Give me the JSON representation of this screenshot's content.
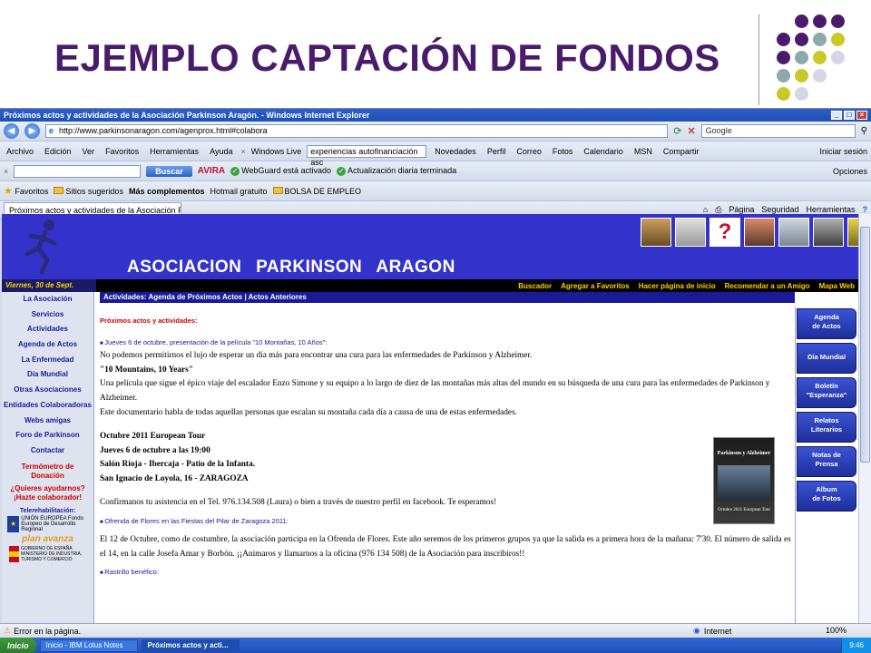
{
  "slide": {
    "title": "EJEMPLO CAPTACIÓN DE FONDOS",
    "dot_colors": [
      "#4b1b6b",
      "#8fa8aa",
      "#c9c92a",
      "#d6d6e6"
    ]
  },
  "browser": {
    "window_title": "Próximos actos y actividades de la Asociación Parkinson Aragón. - Windows Internet Explorer",
    "url": "http://www.parkinsonaragon.com/agenprox.html#colabora",
    "search_placeholder": "Google",
    "menu": [
      "Archivo",
      "Edición",
      "Ver",
      "Favoritos",
      "Herramientas",
      "Ayuda"
    ],
    "live_toolbar": {
      "brand": "Windows Live",
      "search_value": "experiencias autofinanciación asc",
      "links": [
        "Novedades",
        "Perfil",
        "Correo",
        "Fotos",
        "Calendario",
        "MSN",
        "Compartir"
      ],
      "signin": "Iniciar sesión"
    },
    "avira_toolbar": {
      "search_button": "Buscar",
      "brand": "AVIRA",
      "webguard": "WebGuard está activado",
      "update": "Actualización diaria terminada",
      "options": "Opciones"
    },
    "favorites_bar": {
      "favorites": "Favoritos",
      "items": [
        "Sitios sugeridos",
        "Más complementos",
        "Hotmail gratuito",
        "BOLSA DE EMPLEO"
      ]
    },
    "tab_label": "Próximos actos y actividades de la Asociación Parkins...",
    "command_bar": [
      "Página",
      "Seguridad",
      "Herramientas"
    ],
    "status": {
      "text": "Error en la página.",
      "zone": "Internet",
      "zoom": "100%"
    },
    "taskbar": {
      "start": "Inicio",
      "tasks": [
        "Inicio - IBM Lotus Notes",
        "Próximos actos y acti..."
      ],
      "clock": "9:46"
    }
  },
  "site": {
    "name": "ASOCIACION PARKINSON ARAGON",
    "date": "Viernes, 30 de Sept.",
    "top_links": [
      "Buscador",
      "Agregar a Favoritos",
      "Hacer página de inicio",
      "Recomendar a un Amigo",
      "Mapa Web"
    ],
    "left_nav": [
      "La Asociación",
      "Servicios",
      "Actividades",
      "Agenda de Actos",
      "La Enfermedad",
      "Día Mundial",
      "Otras Asociaciones",
      "Entidades Colaboradoras",
      "Webs amigas",
      "Foro de Parkinson",
      "Contactar"
    ],
    "termometro": "Termómetro de Donación",
    "ayudar": "¿Quieres ayudarnos? ¡Hazte colaborador!",
    "telerehab": "Telerehabilitación:",
    "eu_label": "UNIÓN EUROPEA Fondo Europeo de Desarrollo Regional",
    "avanza": "plan avanza",
    "gobierno": "GOBIERNO DE ESPAÑA  MINISTERIO DE INDUSTRIA, TURISMO Y COMERCIO",
    "breadcrumb": "Actividades:   Agenda de Próximos Actos  |   Actos Anteriores",
    "section_title": "Próximos actos y actividades:",
    "item1_head": "Jueves 6 de octubre, presentación de la película \"10 Montañas, 10 Años\":",
    "item1_p1": "No podemos permitirnos el lujo de esperar un día más para encontrar una cura para las enfermedades de Parkinson y Alzheimer.",
    "item1_title_en": "\"10 Mountains, 10 Years\"",
    "item1_p2": "Una película que sigue el épico viaje del escalador Enzo Simone y su equipo a lo largo de diez de las montañas más altas del mundo en su búsqueda de una cura para las enfermedades de Parkinson y Alzheimer.",
    "item1_p3": "Este documentario habla de todas aquellas personas que escalan su montaña cada día a causa de una de estas enfermedades.",
    "event_lines": [
      "Octubre 2011 European Tour",
      "Jueves 6 de octubre a las 19:00",
      "Salón Rioja - Ibercaja - Patio de la Infanta.",
      "San Ignacio de Loyola, 16 - ZARAGOZA"
    ],
    "confirm": "Confirmanos tu asistencia en el Tel. 976.134.508 (Laura) o bien a través de nuestro perfil en facebook. Te esperamos!",
    "poster": {
      "title": "Parkinson y Alzheimer",
      "subtitle": "Octubre 2011 European Tour"
    },
    "item2_head": "Ofrenda de Flores en las Fiestas del Pilar de Zaragoza 2011:",
    "item2_p": "El 12 de Octubre, como de costumbre, la asociación participa en la Ofrenda de Flores. Este año seremos de los primeros grupos ya que la salida es a primera hora de la mañana: 7'30. El número de salida es el 14, en la calle Josefa Amar y Borbón. ¡¡Animaros y llamarnos a la oficina (976 134 508) de la Asociación para inscribiros!!",
    "item3_head": "Rastrillo benéfico:",
    "right_nav": [
      "Agenda\nde Actos",
      "Día Mundial",
      "Boletín\n\"Esperanza\"",
      "Relatos\nLiterarios",
      "Notas de\nPrensa",
      "Album\nde Fotos"
    ]
  }
}
